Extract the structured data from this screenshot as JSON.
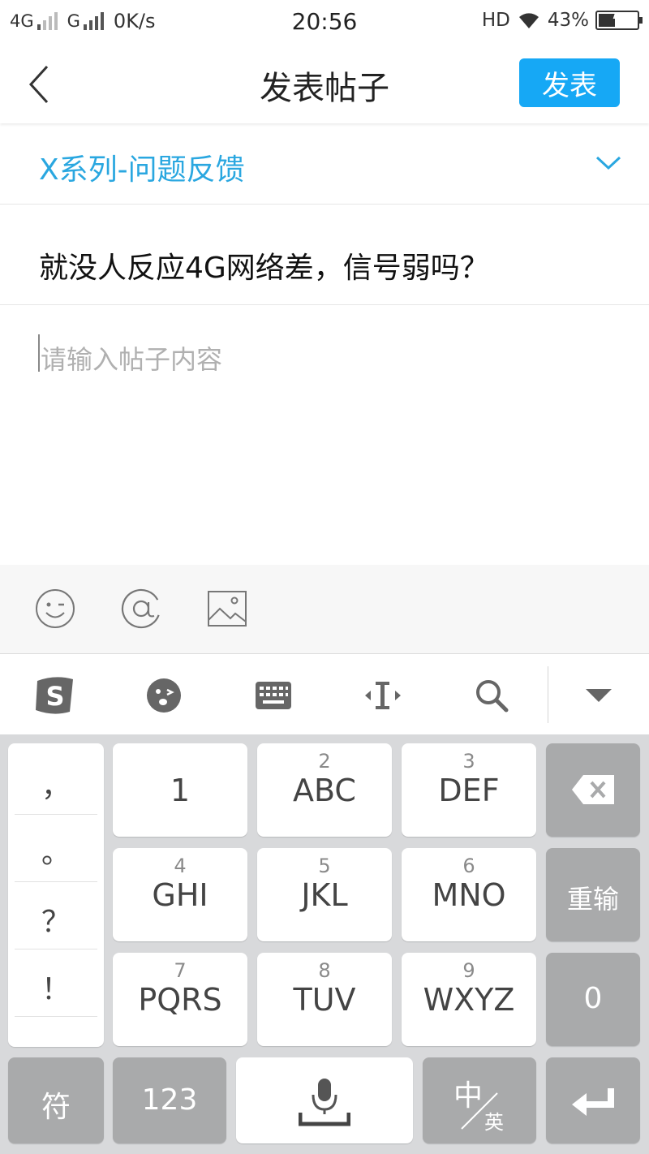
{
  "status_bar": {
    "network_1": "4G",
    "network_2": "G",
    "speed": "0K/s",
    "time": "20:56",
    "hd": "HD",
    "battery": "43%",
    "battery_level": 0.43
  },
  "header": {
    "title": "发表帖子",
    "publish_label": "发表",
    "accent_color": "#16a8f5"
  },
  "category": {
    "label": "X系列-问题反馈",
    "color": "#2aa7e0"
  },
  "post": {
    "title": "就没人反应4G网络差，信号弱吗？",
    "content_placeholder": "请输入帖子内容"
  },
  "toolbar": {
    "icons": [
      "emoji-icon",
      "at-icon",
      "image-icon"
    ]
  },
  "ime_bar": {
    "icons": [
      "sogou-logo-icon",
      "emoji-face-icon",
      "keyboard-icon",
      "cursor-move-icon",
      "search-icon",
      "hide-keyboard-icon"
    ]
  },
  "keyboard": {
    "punctuation": [
      "，",
      "。",
      "？",
      "！"
    ],
    "keys": {
      "k1": {
        "num": "",
        "letters": "1"
      },
      "k2": {
        "num": "2",
        "letters": "ABC"
      },
      "k3": {
        "num": "3",
        "letters": "DEF"
      },
      "k4": {
        "num": "4",
        "letters": "GHI"
      },
      "k5": {
        "num": "5",
        "letters": "JKL"
      },
      "k6": {
        "num": "6",
        "letters": "MNO"
      },
      "k7": {
        "num": "7",
        "letters": "PQRS"
      },
      "k8": {
        "num": "8",
        "letters": "TUV"
      },
      "k9": {
        "num": "9",
        "letters": "WXYZ"
      }
    },
    "reinput_label": "重输",
    "zero_label": "0",
    "symbol_label": "符",
    "numbers_label": "123",
    "lang_top": "中",
    "lang_bottom": "英"
  }
}
